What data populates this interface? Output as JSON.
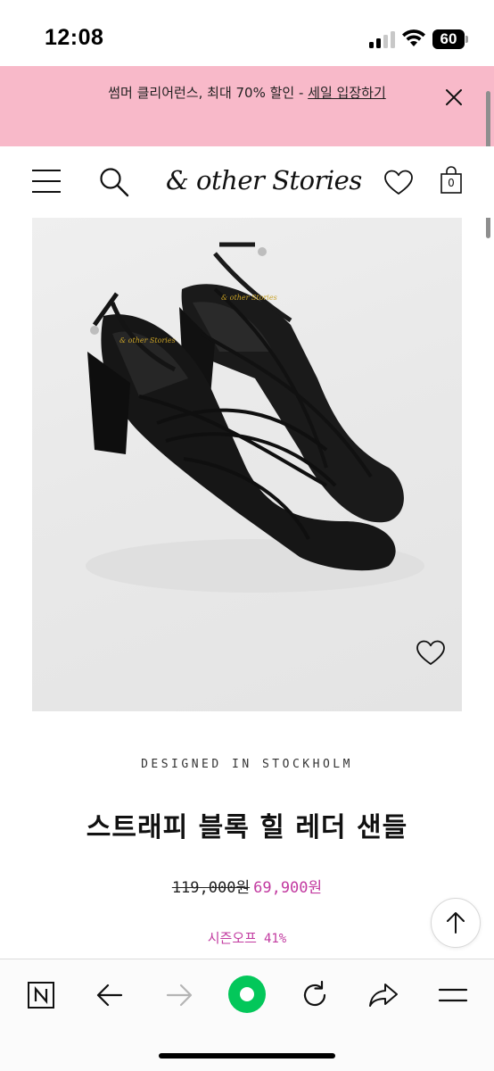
{
  "status_bar": {
    "time": "12:08",
    "battery": "60",
    "icons": [
      "cellular-signal-icon",
      "wifi-icon",
      "battery-icon"
    ]
  },
  "promo": {
    "text": "썸머 클리어런스, 최대 70% 할인 - ",
    "link": "세일 입장하기",
    "background": "#f8b9c9"
  },
  "header": {
    "logo": "& other Stories",
    "cart_count": "0",
    "icons": [
      "menu-icon",
      "search-icon",
      "wishlist-icon",
      "shopping-bag-icon"
    ]
  },
  "product": {
    "image": "black strappy block heel leather sandals",
    "designed": "DESIGNED IN STOCKHOLM",
    "title": "스트래피 블록 힐 레더 샌들",
    "price_original": "119,000원",
    "price_sale": "69,900원",
    "discount_label": "시즌오프",
    "discount_pct": "41%",
    "sale_color": "#c23aa0"
  },
  "browser_toolbar": {
    "icons": [
      "naver-n-icon",
      "back-arrow-icon",
      "forward-arrow-icon",
      "naver-green-dot-icon",
      "refresh-icon",
      "share-icon",
      "menu-lines-icon"
    ],
    "accent": "#03c75a"
  }
}
